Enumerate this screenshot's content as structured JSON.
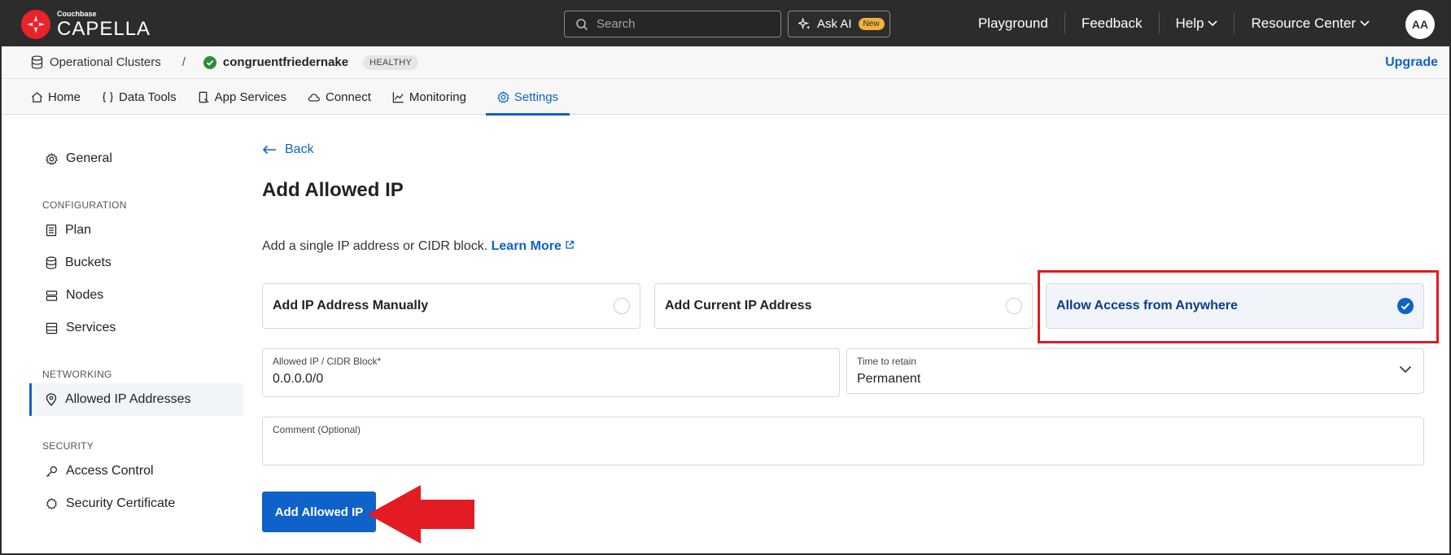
{
  "header": {
    "logo_small": "Couchbase",
    "logo_big": "CAPELLA",
    "search_placeholder": "Search",
    "ask_ai": "Ask AI",
    "ask_ai_badge": "New",
    "links": [
      {
        "label": "Playground"
      },
      {
        "label": "Feedback"
      },
      {
        "label": "Help"
      },
      {
        "label": "Resource Center"
      }
    ],
    "avatar": "AA"
  },
  "breadcrumb": {
    "root": "Operational Clusters",
    "separator": "/",
    "cluster": "congruentfriedernake",
    "status": "HEALTHY",
    "upgrade": "Upgrade"
  },
  "tabs": [
    {
      "label": "Home",
      "icon": "home-icon"
    },
    {
      "label": "Data Tools",
      "icon": "braces-icon"
    },
    {
      "label": "App Services",
      "icon": "device-icon"
    },
    {
      "label": "Connect",
      "icon": "cloud-icon"
    },
    {
      "label": "Monitoring",
      "icon": "chart-icon"
    },
    {
      "label": "Settings",
      "icon": "gear-icon",
      "active": true
    }
  ],
  "sidebar": {
    "general": "General",
    "sections": [
      {
        "title": "CONFIGURATION",
        "items": [
          {
            "label": "Plan"
          },
          {
            "label": "Buckets"
          },
          {
            "label": "Nodes"
          },
          {
            "label": "Services"
          }
        ]
      },
      {
        "title": "NETWORKING",
        "items": [
          {
            "label": "Allowed IP Addresses",
            "active": true
          }
        ]
      },
      {
        "title": "SECURITY",
        "items": [
          {
            "label": "Access Control"
          },
          {
            "label": "Security Certificate"
          }
        ]
      }
    ]
  },
  "main": {
    "back": "Back",
    "title": "Add Allowed IP",
    "description": "Add a single IP address or CIDR block.",
    "learn_more": "Learn More",
    "options": [
      {
        "label": "Add IP Address Manually",
        "selected": false
      },
      {
        "label": "Add Current IP Address",
        "selected": false
      },
      {
        "label": "Allow Access from Anywhere",
        "selected": true
      }
    ],
    "ip_field": {
      "label": "Allowed IP / CIDR Block*",
      "value": "0.0.0.0/0"
    },
    "retain_field": {
      "label": "Time to retain",
      "value": "Permanent"
    },
    "comment_field": {
      "label": "Comment (Optional)",
      "value": ""
    },
    "submit": "Add Allowed IP"
  },
  "colors": {
    "accent": "#0e62c9",
    "topbar": "#2c2c2c",
    "annotation_red": "#e31b23",
    "brand_red": "#ea2328",
    "healthy_green": "#2e8b3a"
  }
}
